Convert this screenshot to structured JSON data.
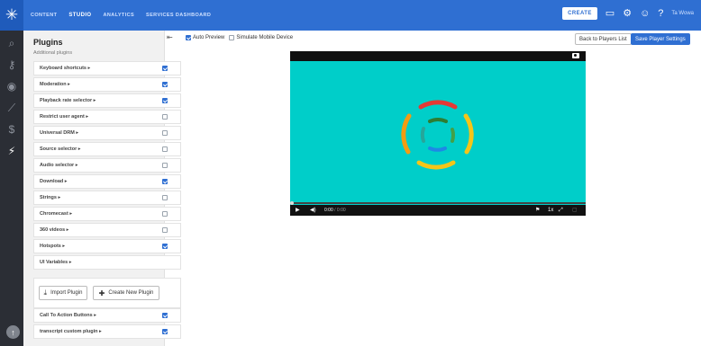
{
  "nav": {
    "items": [
      {
        "label": "CONTENT",
        "active": false
      },
      {
        "label": "STUDIO",
        "active": true
      },
      {
        "label": "ANALYTICS",
        "active": false
      },
      {
        "label": "SERVICES DASHBOARD",
        "active": false
      }
    ],
    "create_label": "CREATE",
    "user_name": "Ta Wowa"
  },
  "sidebar_icons": [
    "search-icon",
    "key-icon",
    "eye-icon",
    "chart-icon",
    "dollar-icon",
    "plug-icon"
  ],
  "panel": {
    "title": "Plugins",
    "subtitle": "Additional plugins",
    "plugins": [
      {
        "label": "Keyboard shortcuts ▸",
        "checked": true
      },
      {
        "label": "Moderation ▸",
        "checked": true
      },
      {
        "label": "Playback rate selector ▸",
        "checked": true
      },
      {
        "label": "Restrict user agent ▸",
        "checked": false
      },
      {
        "label": "Universal DRM ▸",
        "checked": false
      },
      {
        "label": "Source selector ▸",
        "checked": false
      },
      {
        "label": "Audio selector ▸",
        "checked": false
      },
      {
        "label": "Download ▸",
        "checked": true
      },
      {
        "label": "Strings ▸",
        "checked": false
      },
      {
        "label": "Chromecast ▸",
        "checked": false
      },
      {
        "label": "360 videos ▸",
        "checked": false
      },
      {
        "label": "Hotspots ▸",
        "checked": true
      },
      {
        "label": "UI Variables ▸",
        "checked": null
      }
    ],
    "import_label": "Import Plugin",
    "create_label": "Create New Plugin",
    "custom_plugins": [
      {
        "label": "Call To Action Buttons ▸",
        "checked": true
      },
      {
        "label": "transcript custom plugin ▸",
        "checked": true
      }
    ]
  },
  "main": {
    "auto_preview_label": "Auto Preview",
    "auto_preview_checked": true,
    "simulate_mobile_label": "Simulate Mobile Device",
    "simulate_mobile_checked": false,
    "back_label": "Back to Players List",
    "save_label": "Save Player Settings"
  },
  "player": {
    "background_color": "#00cec9",
    "time_current": "0:00",
    "time_total": "/ 0:00",
    "speed_label": "1x"
  },
  "colors": {
    "accent": "#2f6fd2",
    "nav_background": "#2f6fd2",
    "rail_background": "#2b2e35"
  }
}
